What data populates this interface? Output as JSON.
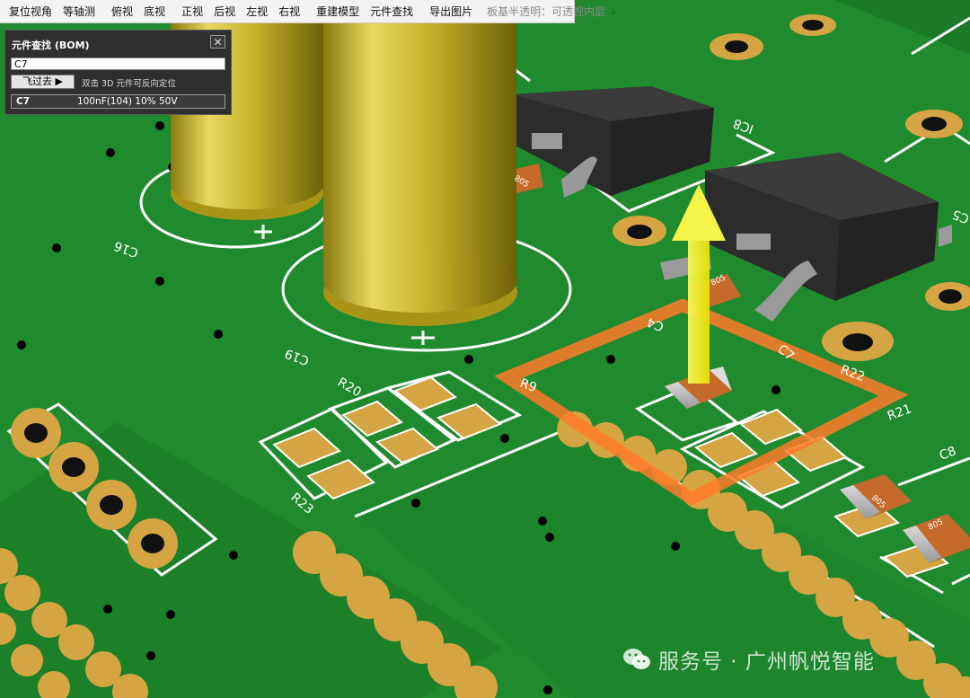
{
  "toolbar": {
    "groups": [
      [
        "复位视角",
        "等轴测"
      ],
      [
        "俯视",
        "底视"
      ],
      [
        "正视",
        "后视",
        "左视",
        "右视"
      ],
      [
        "重建模型",
        "元件查找"
      ],
      [
        "导出图片"
      ]
    ],
    "transparency_label": "板基半透明：可透视内层"
  },
  "bom_panel": {
    "title": "元件查找 (BOM)",
    "close_glyph": "✕",
    "search_value": "C7",
    "go_button": "飞过去 ▶",
    "hint": "双击 3D 元件可反向定位",
    "result": {
      "ref": "C7",
      "value": "100nF(104) 10% 50V"
    }
  },
  "pcb": {
    "silkscreen_labels": [
      "C16",
      "C19",
      "R20",
      "R23",
      "R9",
      "C4",
      "C7",
      "R22",
      "R21",
      "C8",
      "IC8",
      "C5"
    ],
    "package_marks": [
      "805",
      "805",
      "805",
      "805"
    ],
    "highlight_color": "#ff7a2a",
    "board_color": "#1f8a2e",
    "pad_color": "#d6a543",
    "silk_color": "#ffffff"
  },
  "watermark": {
    "icon": "wechat-icon",
    "text": "服务号 · 广州帆悦智能"
  }
}
